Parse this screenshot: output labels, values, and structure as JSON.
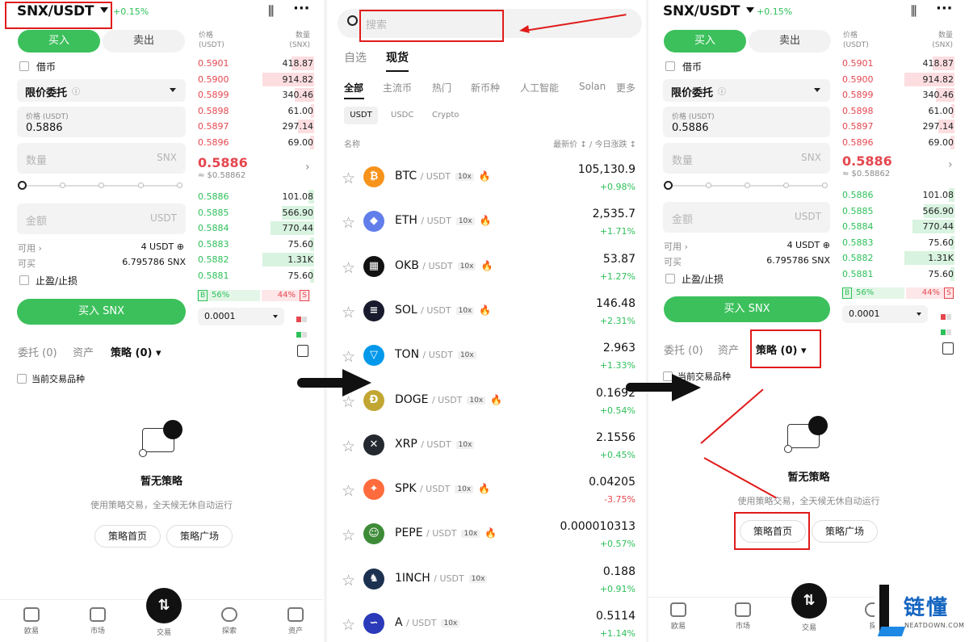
{
  "left": {
    "pair": "SNX/USDT",
    "change": "+0.15%",
    "tabs": {
      "buy": "买入",
      "sell": "卖出"
    },
    "borrow_label": "借币",
    "order_type": "限价委托",
    "price_label": "价格 (USDT)",
    "price_value": "0.5886",
    "qty_placeholder": "数量",
    "qty_unit": "SNX",
    "amount_placeholder": "金额",
    "amount_unit": "USDT",
    "available_label": "可用",
    "available_value": "4 USDT",
    "canbuy_label": "可买",
    "canbuy_value": "6.795786 SNX",
    "tpsl_label": "止盈/止损",
    "buy_button": "买入 SNX",
    "ob_head_price": "价格",
    "ob_head_price_unit": "(USDT)",
    "ob_head_qty": "数量",
    "ob_head_qty_unit": "(SNX)",
    "asks": [
      {
        "p": "0.5901",
        "q": "418.87",
        "w": 0.44
      },
      {
        "p": "0.5900",
        "q": "914.82",
        "w": 1.0
      },
      {
        "p": "0.5899",
        "q": "340.46",
        "w": 0.37
      },
      {
        "p": "0.5898",
        "q": "61.00",
        "w": 0.07
      },
      {
        "p": "0.5897",
        "q": "297.14",
        "w": 0.32
      },
      {
        "p": "0.5896",
        "q": "69.00",
        "w": 0.08
      }
    ],
    "mid_price": "0.5886",
    "mid_usd": "≈ $0.58862",
    "bids": [
      {
        "p": "0.5886",
        "q": "101.08",
        "w": 0.11
      },
      {
        "p": "0.5885",
        "q": "566.90",
        "w": 0.62
      },
      {
        "p": "0.5884",
        "q": "770.44",
        "w": 0.84
      },
      {
        "p": "0.5883",
        "q": "75.60",
        "w": 0.08
      },
      {
        "p": "0.5882",
        "q": "1.31K",
        "w": 1.0
      },
      {
        "p": "0.5881",
        "q": "75.60",
        "w": 0.08
      }
    ],
    "b_label": "B",
    "b_pct": "56%",
    "s_label": "S",
    "s_pct": "44%",
    "depth_value": "0.0001",
    "bottom_tabs": {
      "orders": "委托 (0)",
      "assets": "资产",
      "strategy": "策略 (0)"
    },
    "current_pair_label": "当前交易品种",
    "empty_title": "暂无策略",
    "empty_desc": "使用策略交易，全天候无休自动运行",
    "btn_home": "策略首页",
    "btn_square": "策略广场",
    "nav": [
      "欧易",
      "市场",
      "交易",
      "探索",
      "资产"
    ]
  },
  "market": {
    "search_placeholder": "搜索",
    "top_tabs": [
      "自选",
      "现货"
    ],
    "cat_tabs": [
      "全部",
      "主流币",
      "热门",
      "新币种",
      "人工智能",
      "Solan",
      "更多"
    ],
    "quote_tabs": [
      "USDT",
      "USDC",
      "Crypto"
    ],
    "col_name": "名称",
    "col_price": "最新价 ↕ / 今日涨跌 ↕",
    "coins": [
      {
        "sym": "BTC",
        "q": "/ USDT",
        "lev": "10x",
        "fire": true,
        "price": "105,130.9",
        "chg": "+0.98%",
        "color": "#f7931a",
        "glyph": "₿"
      },
      {
        "sym": "ETH",
        "q": "/ USDT",
        "lev": "10x",
        "fire": true,
        "price": "2,535.7",
        "chg": "+1.71%",
        "color": "#627eea",
        "glyph": "◆"
      },
      {
        "sym": "OKB",
        "q": "/ USDT",
        "lev": "10x",
        "fire": true,
        "price": "53.87",
        "chg": "+1.27%",
        "color": "#111111",
        "glyph": "▦"
      },
      {
        "sym": "SOL",
        "q": "/ USDT",
        "lev": "10x",
        "fire": true,
        "price": "146.48",
        "chg": "+2.31%",
        "color": "#1a1a2e",
        "glyph": "≡"
      },
      {
        "sym": "TON",
        "q": "/ USDT",
        "lev": "10x",
        "fire": false,
        "price": "2.963",
        "chg": "+1.33%",
        "color": "#0098ea",
        "glyph": "▽"
      },
      {
        "sym": "DOGE",
        "q": "/ USDT",
        "lev": "10x",
        "fire": true,
        "price": "0.1692",
        "chg": "+0.54%",
        "color": "#c2a633",
        "glyph": "Ð"
      },
      {
        "sym": "XRP",
        "q": "/ USDT",
        "lev": "10x",
        "fire": false,
        "price": "2.1556",
        "chg": "+0.45%",
        "color": "#23292f",
        "glyph": "✕"
      },
      {
        "sym": "SPK",
        "q": "/ USDT",
        "lev": "10x",
        "fire": true,
        "price": "0.04205",
        "chg": "-3.75%",
        "color": "#ff6b3d",
        "glyph": "✦"
      },
      {
        "sym": "PEPE",
        "q": "/ USDT",
        "lev": "10x",
        "fire": true,
        "price": "0.000010313",
        "chg": "+0.57%",
        "color": "#3d8b37",
        "glyph": "☺"
      },
      {
        "sym": "1INCH",
        "q": "/ USDT",
        "lev": "10x",
        "fire": false,
        "price": "0.188",
        "chg": "+0.91%",
        "color": "#1b314f",
        "glyph": "♞"
      },
      {
        "sym": "A",
        "q": "/ USDT",
        "lev": "10x",
        "fire": false,
        "price": "0.5114",
        "chg": "+1.14%",
        "color": "#2a3ab8",
        "glyph": "∽"
      }
    ]
  },
  "right": {
    "pair": "SNX/USDT",
    "change": "+0.15%",
    "nav": [
      "欧易",
      "市场",
      "交易",
      "探"
    ]
  },
  "watermark": {
    "cn": "链懂",
    "en": "NEATDOWN.COM"
  }
}
